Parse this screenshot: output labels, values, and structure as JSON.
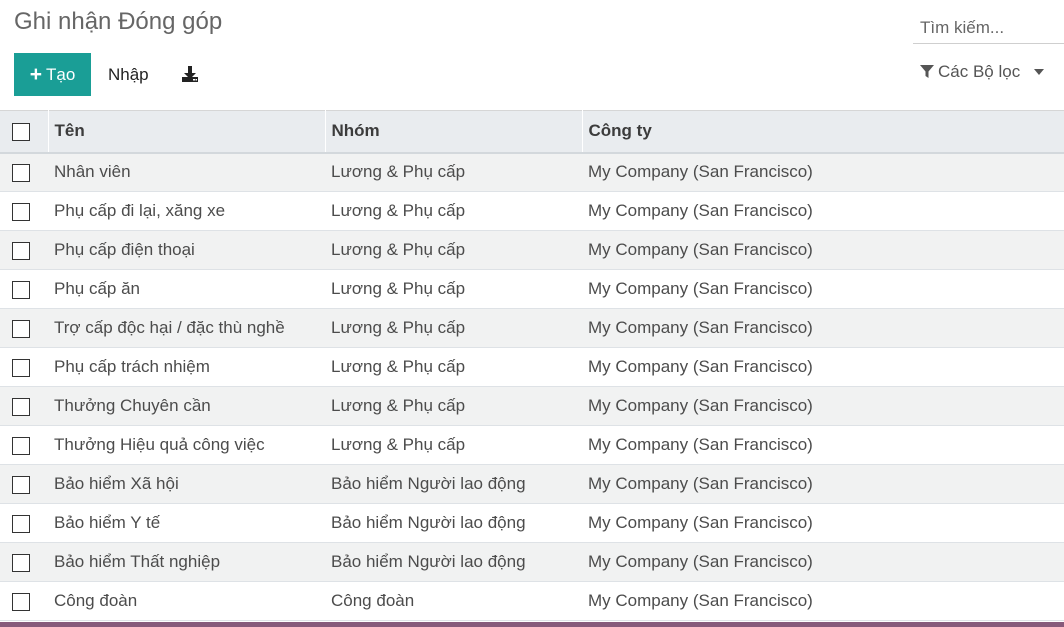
{
  "header": {
    "title": "Ghi nhận Đóng góp",
    "search_placeholder": "Tìm kiếm..."
  },
  "toolbar": {
    "create_plus": "+",
    "create_label": "Tạo",
    "import_label": "Nhập",
    "download_icon": "download-icon",
    "filter_label": "Các Bộ lọc",
    "filter_icon": "funnel-icon"
  },
  "table": {
    "columns": [
      "Tên",
      "Nhóm",
      "Công ty"
    ],
    "rows": [
      {
        "name": "Nhân viên",
        "group": "Lương & Phụ cấp",
        "company": "My Company (San Francisco)"
      },
      {
        "name": "Phụ cấp đi lại, xăng xe",
        "group": "Lương & Phụ cấp",
        "company": "My Company (San Francisco)"
      },
      {
        "name": "Phụ cấp điện thoại",
        "group": "Lương & Phụ cấp",
        "company": "My Company (San Francisco)"
      },
      {
        "name": "Phụ cấp ăn",
        "group": "Lương & Phụ cấp",
        "company": "My Company (San Francisco)"
      },
      {
        "name": "Trợ cấp độc hại / đặc thù nghề",
        "group": "Lương & Phụ cấp",
        "company": "My Company (San Francisco)"
      },
      {
        "name": "Phụ cấp trách nhiệm",
        "group": "Lương & Phụ cấp",
        "company": "My Company (San Francisco)"
      },
      {
        "name": "Thưởng Chuyên cần",
        "group": "Lương & Phụ cấp",
        "company": "My Company (San Francisco)"
      },
      {
        "name": "Thưởng Hiệu quả công việc",
        "group": "Lương & Phụ cấp",
        "company": "My Company (San Francisco)"
      },
      {
        "name": "Bảo hiểm Xã hội",
        "group": "Bảo hiểm Người lao động",
        "company": "My Company (San Francisco)"
      },
      {
        "name": "Bảo hiểm Y tế",
        "group": "Bảo hiểm Người lao động",
        "company": "My Company (San Francisco)"
      },
      {
        "name": "Bảo hiểm Thất nghiệp",
        "group": "Bảo hiểm Người lao động",
        "company": "My Company (San Francisco)"
      },
      {
        "name": "Công đoàn",
        "group": "Công đoàn",
        "company": "My Company (San Francisco)"
      }
    ]
  },
  "colors": {
    "primary": "#1a9e96",
    "brand_bar": "#875a7b",
    "header_bg": "#e9ecef",
    "row_alt": "#f1f2f2"
  }
}
